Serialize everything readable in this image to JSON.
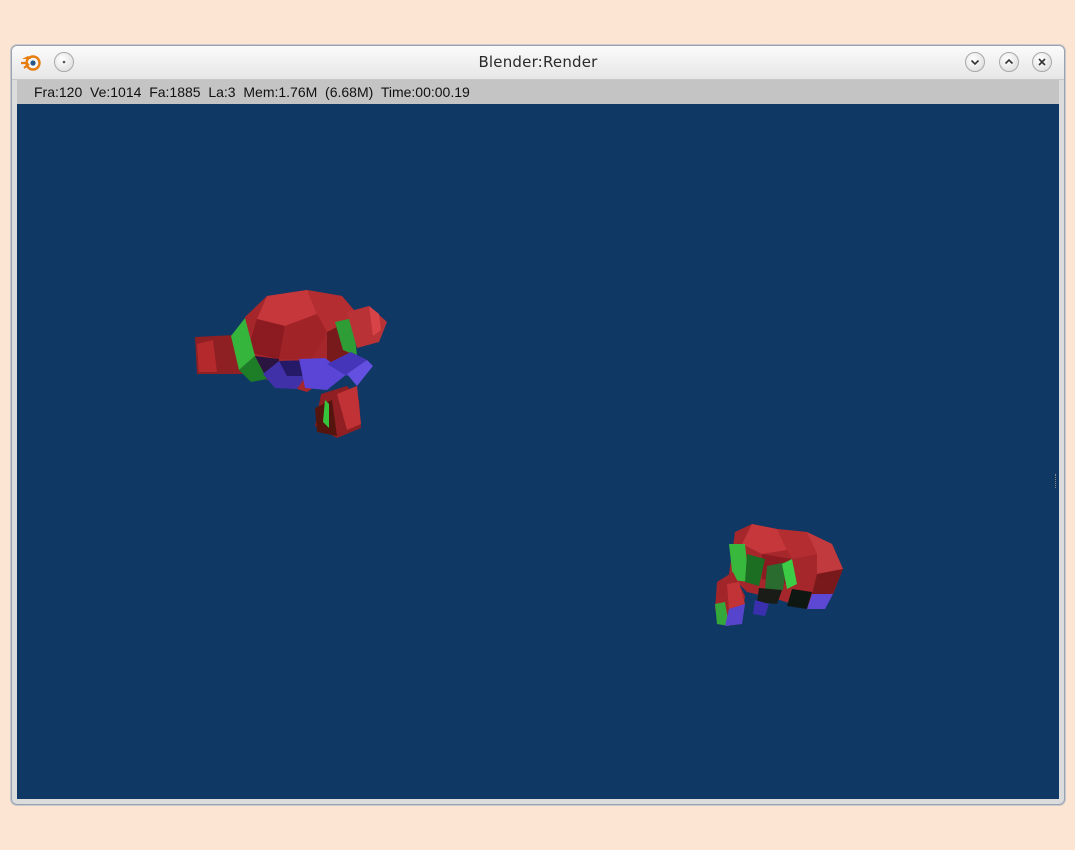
{
  "window": {
    "title": "Blender:Render"
  },
  "statusbar": {
    "text": "Fra:120  Ve:1014  Fa:1885  La:3  Mem:1.76M  (6.68M)  Time:00:00.19"
  },
  "viewport": {
    "background_color": "#103864",
    "objects": [
      "monkey-mesh-left",
      "monkey-mesh-right"
    ]
  },
  "icons": {
    "app": "blender-logo-icon",
    "menu": "window-menu-icon",
    "minimize": "chevron-down-icon",
    "maximize": "chevron-up-icon",
    "close": "close-icon"
  }
}
